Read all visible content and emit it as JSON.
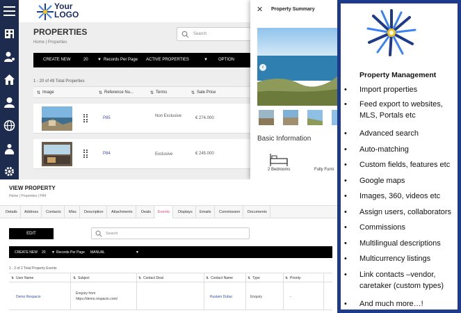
{
  "app": {
    "logo": {
      "line1": "Your",
      "line2": "LOGO"
    },
    "page_title": "PROPERTIES",
    "breadcrumb": "Home  |  Properties",
    "search_placeholder": "Search",
    "toolbar": {
      "create_new": "CREATE NEW",
      "records_value": "20",
      "records_label": "Records Per Page",
      "filter_value": "ACTIVE PROPERTIES",
      "option_label": "OPTION"
    },
    "total_label": "1 - 20 of 49 Total Properties",
    "columns": [
      "Image",
      "Reference Nu...",
      "Terms",
      "Sale Price"
    ],
    "rows": [
      {
        "ref": "P85",
        "terms": "Non Exclusive",
        "price": "€ 274.000"
      },
      {
        "ref": "P84",
        "terms": "Exclusive",
        "price": "€ 245.000"
      }
    ]
  },
  "summary": {
    "title": "Property Summary",
    "basic_info": "Basic Information",
    "bedrooms": "2 Bedrooms",
    "furnished": "Fully Furni"
  },
  "view": {
    "title": "VIEW PROPERTY",
    "breadcrumb": "Home  |  Properties  |  P84",
    "tabs": [
      "Details",
      "Address",
      "Contacts",
      "Misc",
      "Description",
      "Attachments",
      "Deals",
      "Events",
      "Displays",
      "Emails",
      "Commission",
      "Documents"
    ],
    "active_tab": "Events",
    "edit_label": "EDIT",
    "search_placeholder": "Search",
    "toolbar": {
      "create_new": "CREATE NEW",
      "records_value": "20",
      "records_label": "Records Per Page",
      "filter_value": "MANUAL"
    },
    "total_label": "1 - 2 of 2 Total Property Events",
    "columns": [
      "User Name",
      "Subject",
      "Contact Deal",
      "Contact Name",
      "Type",
      "Priority"
    ],
    "row": {
      "user": "Demo Respacio",
      "subject_line1": "Enquiry from",
      "subject_line2": "https://demo.respacio.com/",
      "contact_name": "Rustam Dubai",
      "type": "Enquiry",
      "priority": "-"
    }
  },
  "features": {
    "title": "Property Management",
    "items": [
      "Import properties",
      "Feed export to websites, MLS, Portals etc",
      "Advanced search",
      "Auto-matching",
      "Custom fields, features etc",
      "Google maps",
      "Images, 360, videos etc",
      "Assign users, collaborators",
      "Commissions",
      "Multilingual descriptions",
      "Multicurrency listings",
      "Link contacts –vendor, caretaker (custom types)",
      "And much more…!"
    ],
    "border_color": "#1e3a8a"
  },
  "colors": {
    "sidebar": "#1d2b4f",
    "active_tab": "#e0457b",
    "link": "#3b4da8"
  }
}
